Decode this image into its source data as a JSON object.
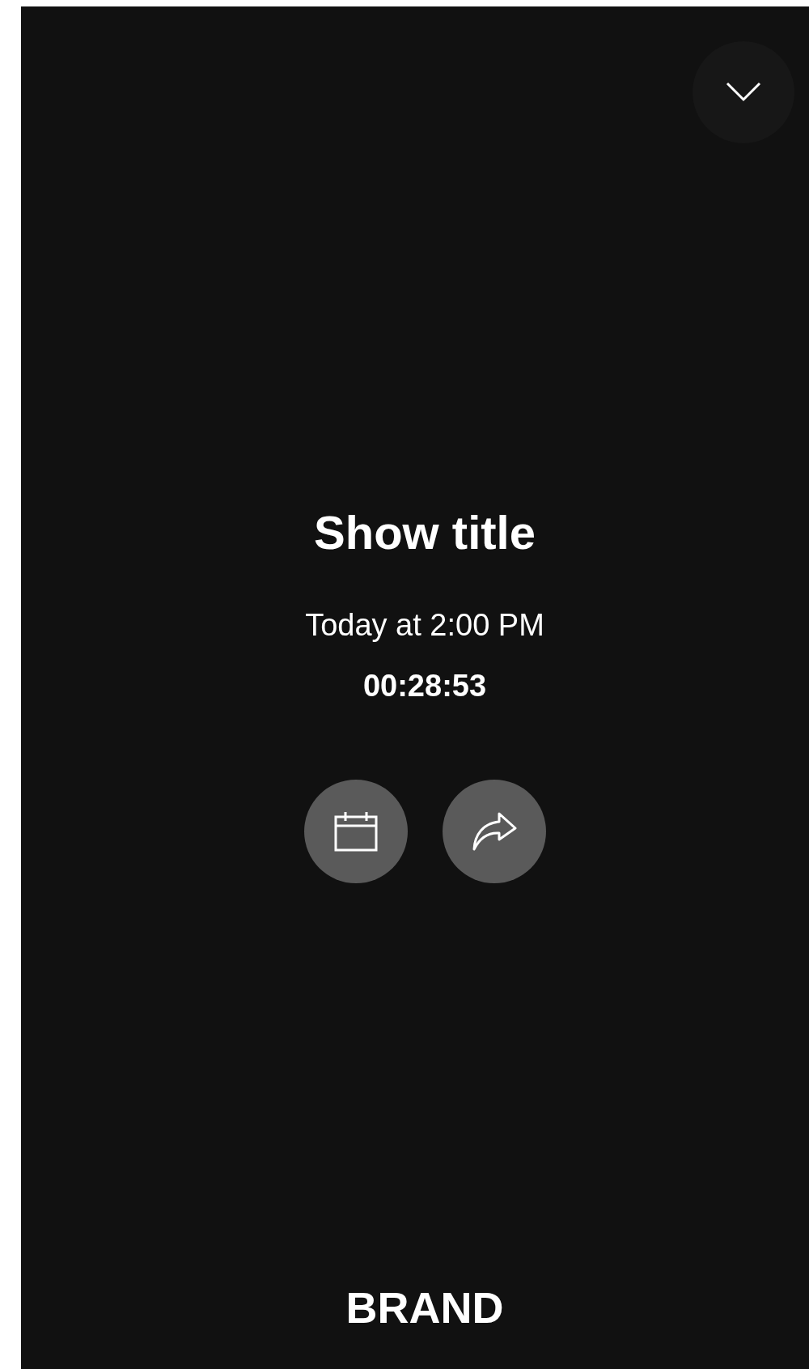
{
  "show": {
    "title": "Show title",
    "schedule": "Today at 2:00 PM",
    "countdown": "00:28:53"
  },
  "actions": [
    {
      "kind": "calendar"
    },
    {
      "kind": "share"
    }
  ],
  "brand": "BRAND"
}
